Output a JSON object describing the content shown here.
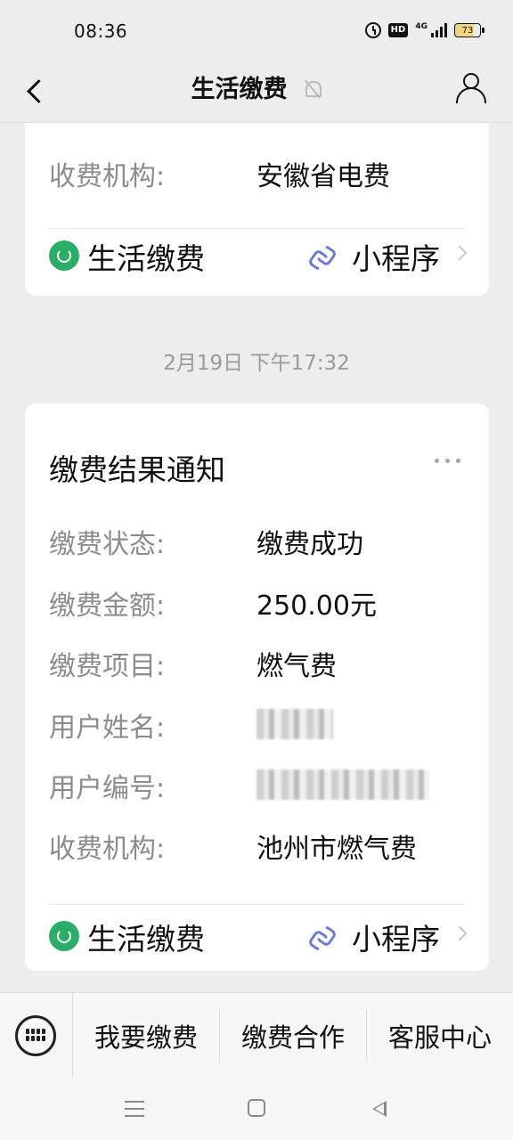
{
  "status_bar": {
    "time": "08:36",
    "hd": "HD",
    "network": "4G",
    "battery": "73"
  },
  "nav": {
    "title": "生活缴费"
  },
  "top_card": {
    "rows": [
      {
        "label": "收费机构:",
        "value": "安徽省电费"
      }
    ],
    "footer": {
      "app_name": "生活缴费",
      "mini_program_label": "小程序"
    }
  },
  "timestamp": "2月19日 下午17:32",
  "main_card": {
    "title": "缴费结果通知",
    "rows": [
      {
        "label": "缴费状态:",
        "value": "缴费成功"
      },
      {
        "label": "缴费金额:",
        "value": "250.00元"
      },
      {
        "label": "缴费项目:",
        "value": "燃气费"
      },
      {
        "label": "用户姓名:",
        "value": ""
      },
      {
        "label": "用户编号:",
        "value": ""
      },
      {
        "label": "收费机构:",
        "value": "池州市燃气费"
      }
    ],
    "footer": {
      "app_name": "生活缴费",
      "mini_program_label": "小程序"
    }
  },
  "bottom_menu": {
    "items": [
      "我要缴费",
      "缴费合作",
      "客服中心"
    ]
  },
  "colors": {
    "background": "#ededed",
    "card": "#ffffff",
    "label": "#8c8c8c",
    "app_icon": "#2aae67",
    "mini_program_icon": "#6b7cd6"
  }
}
